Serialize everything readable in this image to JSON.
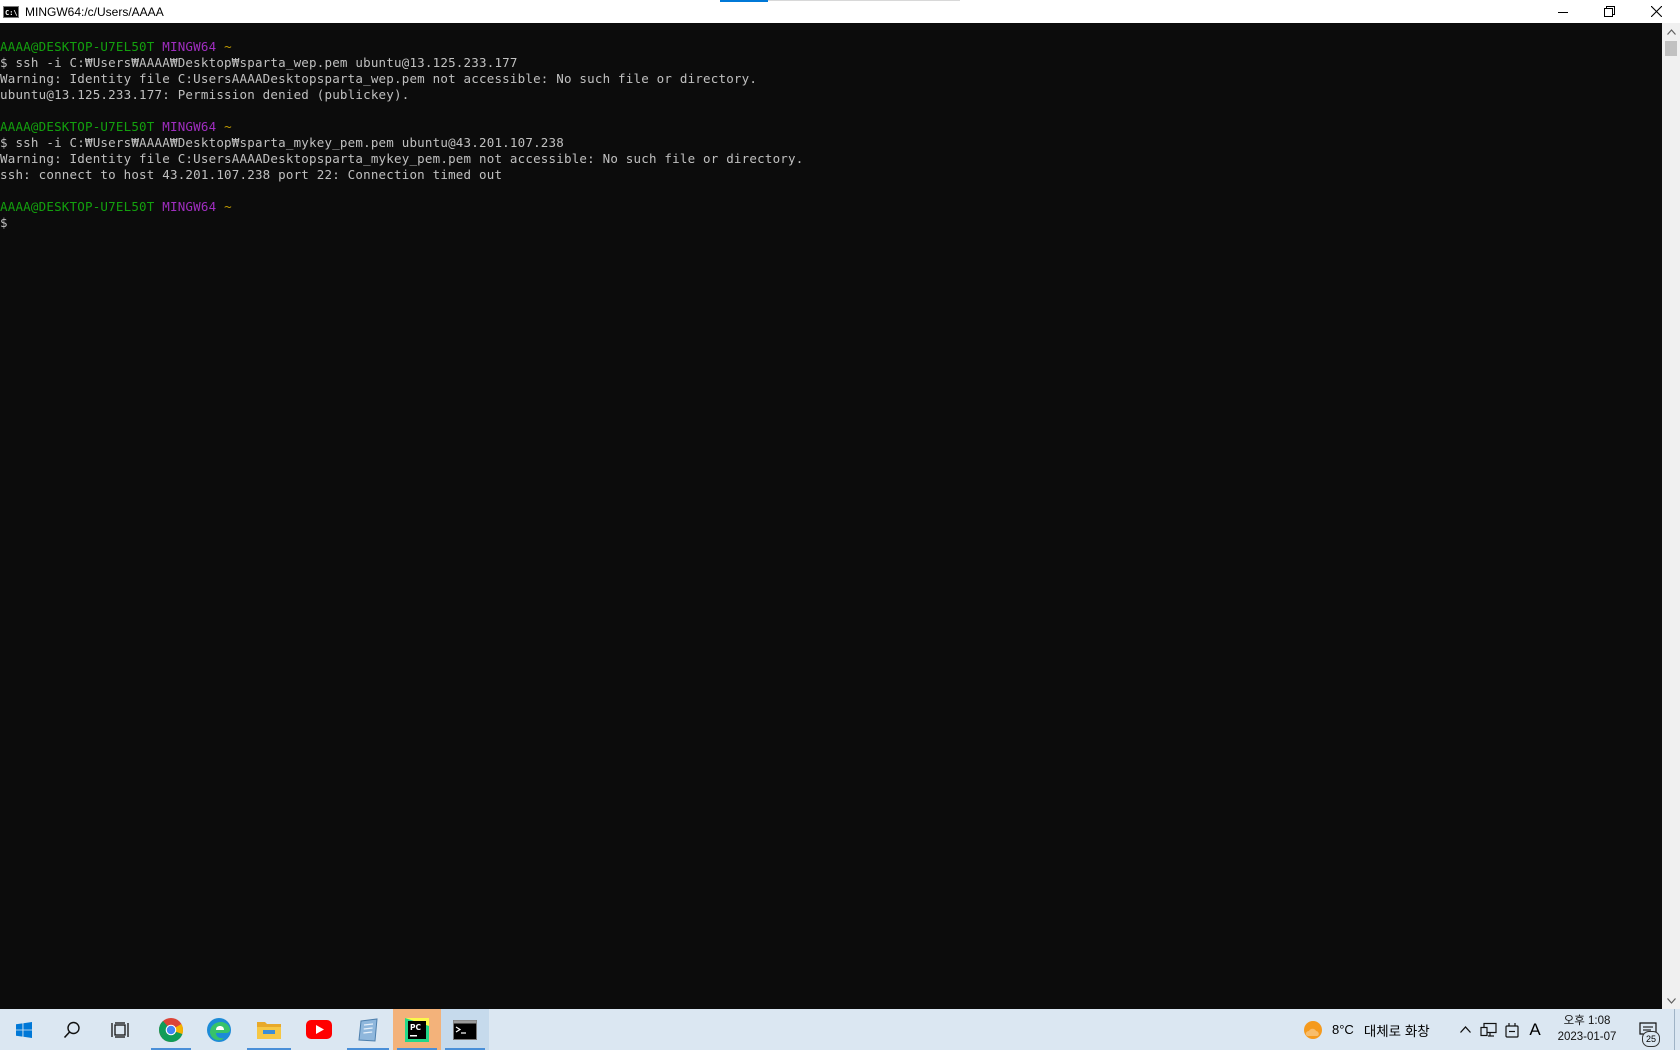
{
  "window": {
    "title": "MINGW64:/c/Users/AAAA",
    "icon_label": "C:\\"
  },
  "terminal": {
    "lines": [
      {
        "type": "prompt",
        "user": "AAAA@DESKTOP-U7EL50T",
        "shell": "MINGW64",
        "dir": "~"
      },
      {
        "type": "text",
        "text": "$ ssh -i C:₩Users₩AAAA₩Desktop₩sparta_wep.pem ubuntu@13.125.233.177"
      },
      {
        "type": "text",
        "text": "Warning: Identity file C:UsersAAAADesktopsparta_wep.pem not accessible: No such file or directory."
      },
      {
        "type": "text",
        "text": "ubuntu@13.125.233.177: Permission denied (publickey)."
      },
      {
        "type": "blank",
        "text": ""
      },
      {
        "type": "prompt",
        "user": "AAAA@DESKTOP-U7EL50T",
        "shell": "MINGW64",
        "dir": "~"
      },
      {
        "type": "text",
        "text": "$ ssh -i C:₩Users₩AAAA₩Desktop₩sparta_mykey_pem.pem ubuntu@43.201.107.238"
      },
      {
        "type": "text",
        "text": "Warning: Identity file C:UsersAAAADesktopsparta_mykey_pem.pem not accessible: No such file or directory."
      },
      {
        "type": "text",
        "text": "ssh: connect to host 43.201.107.238 port 22: Connection timed out"
      },
      {
        "type": "blank",
        "text": ""
      },
      {
        "type": "prompt",
        "user": "AAAA@DESKTOP-U7EL50T",
        "shell": "MINGW64",
        "dir": "~"
      },
      {
        "type": "text",
        "text": "$"
      }
    ],
    "colors": {
      "prompt_user": "#13a10e",
      "prompt_shell": "#a02ec0",
      "prompt_dir": "#c19c00",
      "text": "#c0c0c0",
      "background": "#0c0c0c"
    }
  },
  "taskbar": {
    "apps": [
      {
        "name": "start-button",
        "icon": "windows-logo-icon"
      },
      {
        "name": "search-button",
        "icon": "search-icon"
      },
      {
        "name": "task-view-button",
        "icon": "task-view-icon"
      },
      {
        "name": "chrome-app",
        "icon": "chrome-icon"
      },
      {
        "name": "edge-app",
        "icon": "edge-icon"
      },
      {
        "name": "file-explorer-app",
        "icon": "folder-icon"
      },
      {
        "name": "youtube-app",
        "icon": "youtube-icon"
      },
      {
        "name": "notepad-app",
        "icon": "notepad-icon"
      },
      {
        "name": "pycharm-app",
        "icon": "pycharm-icon",
        "label": "PC"
      },
      {
        "name": "git-bash-app",
        "icon": "terminal-icon"
      }
    ],
    "weather": {
      "temp": "8°C",
      "desc": "대체로 화창"
    },
    "ime_label": "A",
    "clock": {
      "time": "오후 1:08",
      "date": "2023-01-07"
    },
    "notification_count": "25"
  }
}
